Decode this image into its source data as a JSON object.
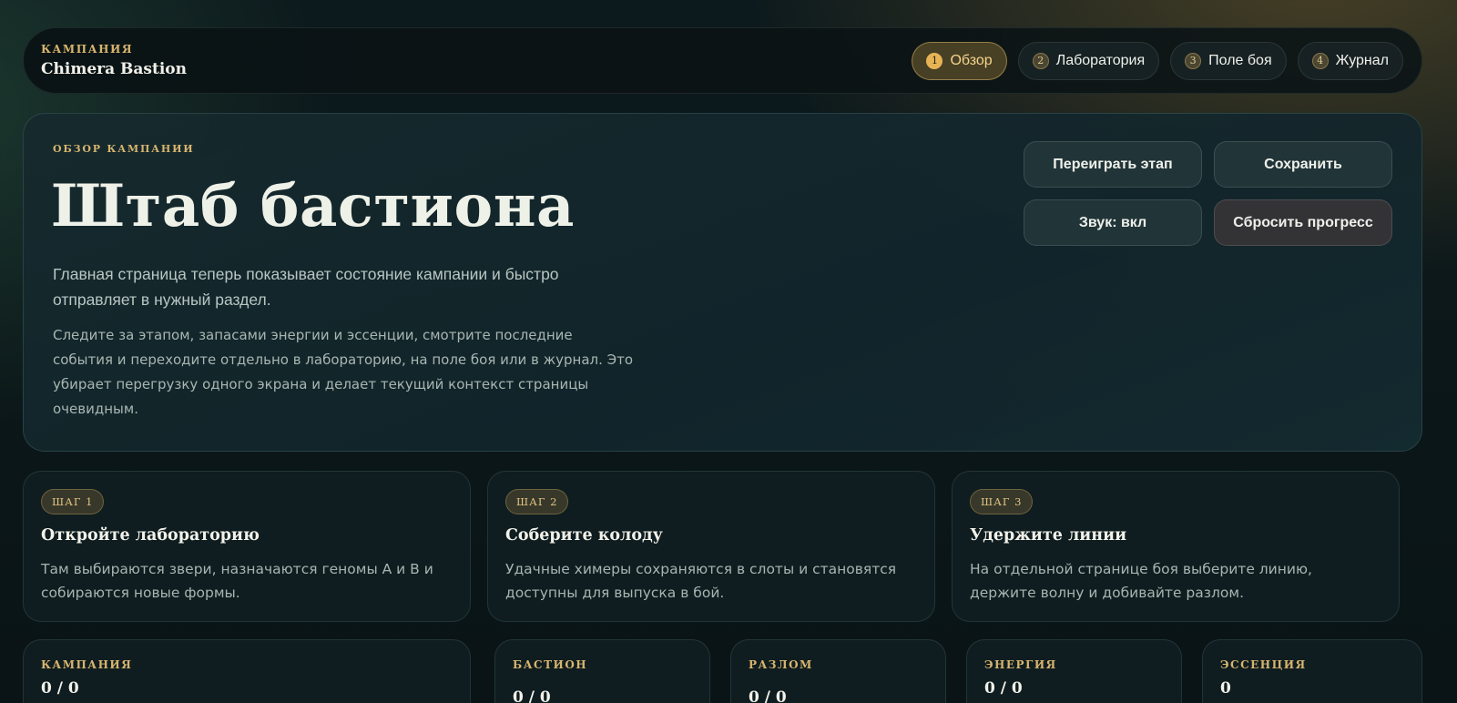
{
  "brand": {
    "kicker": "КАМПАНИЯ",
    "title": "Chimera Bastion"
  },
  "nav": {
    "tabs": [
      {
        "num": "1",
        "label": "Обзор",
        "active": true
      },
      {
        "num": "2",
        "label": "Лаборатория",
        "active": false
      },
      {
        "num": "3",
        "label": "Поле боя",
        "active": false
      },
      {
        "num": "4",
        "label": "Журнал",
        "active": false
      }
    ]
  },
  "hero": {
    "kicker": "ОБЗОР КАМПАНИИ",
    "title": "Штаб бастиона",
    "lead": "Главная страница теперь показывает состояние кампании и быстро отправляет в нужный раздел.",
    "body": "Следите за этапом, запасами энергии и эссенции, смотрите последние события и переходите отдельно в лабораторию, на поле боя или в журнал. Это убирает перегрузку одного экрана и делает текущий контекст страницы очевидным.",
    "actions": {
      "replay": "Переиграть этап",
      "save": "Сохранить",
      "sound": "Звук: вкл",
      "reset": "Сбросить прогресс"
    }
  },
  "steps": [
    {
      "badge": "ШАГ 1",
      "title": "Откройте лабораторию",
      "text": "Там выбираются звери, назначаются геномы A и B и собираются новые формы."
    },
    {
      "badge": "ШАГ 2",
      "title": "Соберите колоду",
      "text": "Удачные химеры сохраняются в слоты и становятся доступны для выпуска в бой."
    },
    {
      "badge": "ШАГ 3",
      "title": "Удержите линии",
      "text": "На отдельной странице боя выберите линию, держите волну и добивайте разлом."
    }
  ],
  "stats": [
    {
      "label": "КАМПАНИЯ",
      "value": "0 / 0"
    },
    {
      "label": "БАСТИОН",
      "value": "0 / 0"
    },
    {
      "label": "РАЗЛОМ",
      "value": "0 / 0"
    },
    {
      "label": "ЭНЕРГИЯ",
      "value": "0 / 0"
    },
    {
      "label": "ЭССЕНЦИЯ",
      "value": "0"
    }
  ]
}
